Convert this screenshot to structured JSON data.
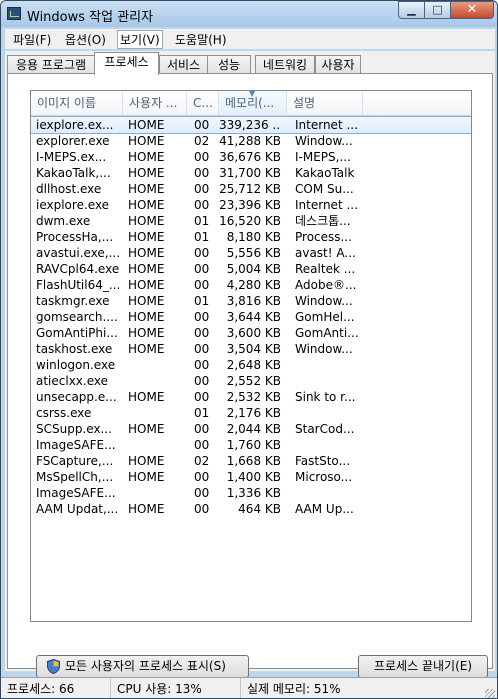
{
  "window": {
    "title": "Windows 작업 관리자"
  },
  "menu": [
    "파일(F)",
    "옵션(O)",
    "보기(V)",
    "도움말(H)"
  ],
  "tabs": [
    "응용 프로그램",
    "프로세스",
    "서비스",
    "성능",
    "네트워킹",
    "사용자"
  ],
  "columns": [
    "이미지 이름",
    "사용자 ...",
    "C...",
    "메모리(...",
    "설명"
  ],
  "processes": [
    {
      "name": "iexplore.ex...",
      "user": "HOME",
      "cpu": "00",
      "mem": "339,236 ...",
      "desc": "Internet ..."
    },
    {
      "name": "explorer.exe",
      "user": "HOME",
      "cpu": "02",
      "mem": "41,288 KB",
      "desc": "Window..."
    },
    {
      "name": "I-MEPS.ex...",
      "user": "HOME",
      "cpu": "00",
      "mem": "36,676 KB",
      "desc": "I-MEPS,..."
    },
    {
      "name": "KakaoTalk,...",
      "user": "HOME",
      "cpu": "00",
      "mem": "31,700 KB",
      "desc": "KakaoTalk"
    },
    {
      "name": "dllhost.exe",
      "user": "HOME",
      "cpu": "00",
      "mem": "25,712 KB",
      "desc": "COM Su..."
    },
    {
      "name": "iexplore.exe",
      "user": "HOME",
      "cpu": "00",
      "mem": "23,396 KB",
      "desc": "Internet ..."
    },
    {
      "name": "dwm.exe",
      "user": "HOME",
      "cpu": "01",
      "mem": "16,520 KB",
      "desc": "데스크톱..."
    },
    {
      "name": "ProcessHa,...",
      "user": "HOME",
      "cpu": "01",
      "mem": "8,180 KB",
      "desc": "Process..."
    },
    {
      "name": "avastui.exe,...",
      "user": "HOME",
      "cpu": "00",
      "mem": "5,556 KB",
      "desc": "avast! A..."
    },
    {
      "name": "RAVCpl64.exe",
      "user": "HOME",
      "cpu": "00",
      "mem": "5,004 KB",
      "desc": "Realtek ..."
    },
    {
      "name": "FlashUtil64_...",
      "user": "HOME",
      "cpu": "00",
      "mem": "4,280 KB",
      "desc": "Adobe®..."
    },
    {
      "name": "taskmgr.exe",
      "user": "HOME",
      "cpu": "01",
      "mem": "3,816 KB",
      "desc": "Window..."
    },
    {
      "name": "gomsearch....",
      "user": "HOME",
      "cpu": "00",
      "mem": "3,644 KB",
      "desc": "GomHel..."
    },
    {
      "name": "GomAntiPhi...",
      "user": "HOME",
      "cpu": "00",
      "mem": "3,600 KB",
      "desc": "GomAnti..."
    },
    {
      "name": "taskhost.exe",
      "user": "HOME",
      "cpu": "00",
      "mem": "3,504 KB",
      "desc": "Window..."
    },
    {
      "name": "winlogon.exe",
      "user": "",
      "cpu": "00",
      "mem": "2,648 KB",
      "desc": ""
    },
    {
      "name": "atieclxx.exe",
      "user": "",
      "cpu": "00",
      "mem": "2,552 KB",
      "desc": ""
    },
    {
      "name": "unsecapp.e...",
      "user": "HOME",
      "cpu": "00",
      "mem": "2,532 KB",
      "desc": "Sink to r..."
    },
    {
      "name": "csrss.exe",
      "user": "",
      "cpu": "01",
      "mem": "2,176 KB",
      "desc": ""
    },
    {
      "name": "SCSupp.ex...",
      "user": "HOME",
      "cpu": "00",
      "mem": "2,044 KB",
      "desc": "StarCod..."
    },
    {
      "name": "ImageSAFE...",
      "user": "",
      "cpu": "00",
      "mem": "1,760 KB",
      "desc": ""
    },
    {
      "name": "FSCapture,...",
      "user": "HOME",
      "cpu": "02",
      "mem": "1,668 KB",
      "desc": "FastSto..."
    },
    {
      "name": "MsSpellCh,...",
      "user": "HOME",
      "cpu": "00",
      "mem": "1,400 KB",
      "desc": "Microso..."
    },
    {
      "name": "ImageSAFE...",
      "user": "",
      "cpu": "00",
      "mem": "1,336 KB",
      "desc": ""
    },
    {
      "name": "AAM Updat,...",
      "user": "HOME",
      "cpu": "00",
      "mem": "464 KB",
      "desc": "AAM Up..."
    }
  ],
  "buttons": {
    "show_all": "모든 사용자의 프로세스 표시(S)",
    "end_process": "프로세스 끝내기(E)"
  },
  "status": {
    "processes": "프로세스: 66",
    "cpu": "CPU 사용: 13%",
    "memory": "실제 메모리: 51%"
  }
}
